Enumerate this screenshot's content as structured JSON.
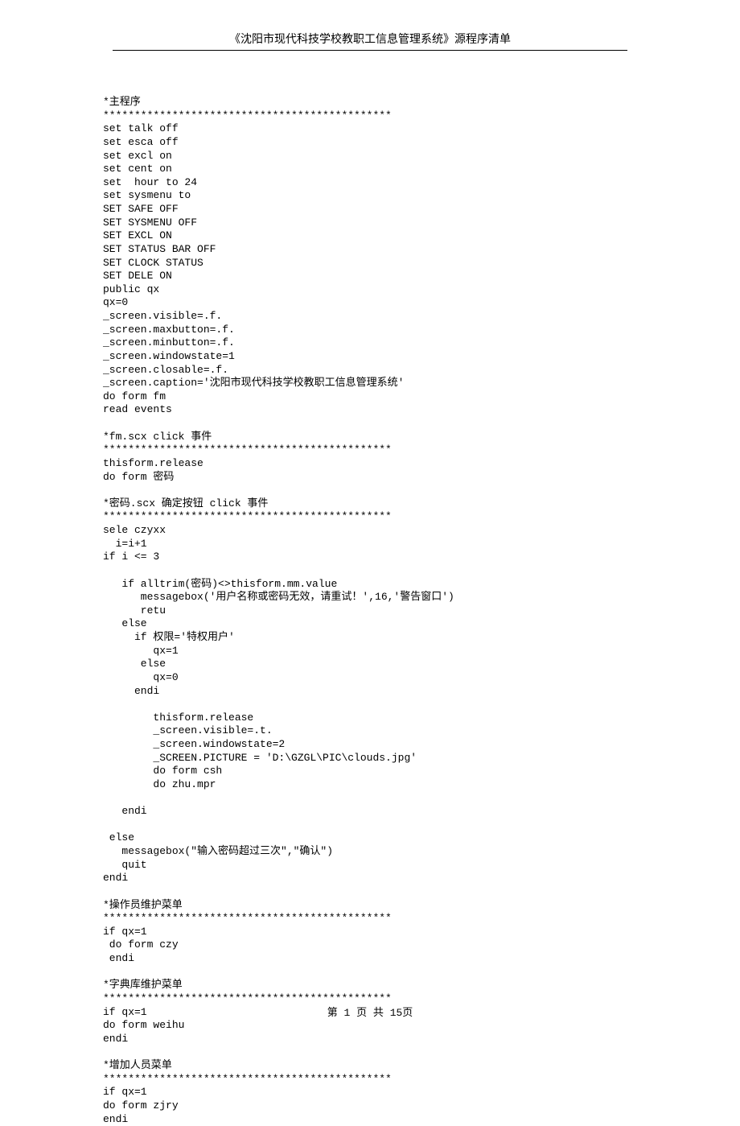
{
  "header": {
    "title": "《沈阳市现代科技学校教职工信息管理系统》源程序清单"
  },
  "code": {
    "lines": [
      "*主程序",
      "**********************************************",
      "set talk off",
      "set esca off",
      "set excl on",
      "set cent on",
      "set  hour to 24",
      "set sysmenu to",
      "SET SAFE OFF",
      "SET SYSMENU OFF",
      "SET EXCL ON",
      "SET STATUS BAR OFF",
      "SET CLOCK STATUS",
      "SET DELE ON",
      "public qx",
      "qx=0",
      "_screen.visible=.f.",
      "_screen.maxbutton=.f.",
      "_screen.minbutton=.f.",
      "_screen.windowstate=1",
      "_screen.closable=.f.",
      "_screen.caption='沈阳市现代科技学校教职工信息管理系统'",
      "do form fm",
      "read events",
      "",
      "*fm.scx click 事件",
      "**********************************************",
      "thisform.release",
      "do form 密码",
      "",
      "*密码.scx 确定按钮 click 事件",
      "**********************************************",
      "sele czyxx",
      "  i=i+1",
      "if i <= 3",
      "",
      "   if alltrim(密码)<>thisform.mm.value",
      "      messagebox('用户名称或密码无效，请重试！',16,'警告窗口')",
      "      retu",
      "   else",
      "     if 权限='特权用户'",
      "        qx=1",
      "      else",
      "        qx=0",
      "     endi",
      "",
      "        thisform.release",
      "        _screen.visible=.t.",
      "        _screen.windowstate=2",
      "        _SCREEN.PICTURE = 'D:\\GZGL\\PIC\\clouds.jpg'",
      "        do form csh",
      "        do zhu.mpr",
      "",
      "   endi",
      "",
      " else",
      "   messagebox(\"输入密码超过三次\",\"确认\")",
      "   quit",
      "endi",
      "",
      "*操作员维护菜单",
      "**********************************************",
      "if qx=1",
      " do form czy",
      " endi",
      "",
      "*字典库维护菜单",
      "**********************************************",
      "if qx=1",
      "do form weihu",
      "endi",
      "",
      "*增加人员菜单",
      "**********************************************",
      "if qx=1",
      "do form zjry",
      "endi"
    ]
  },
  "footer": {
    "text": "第 1 页 共 15页"
  }
}
